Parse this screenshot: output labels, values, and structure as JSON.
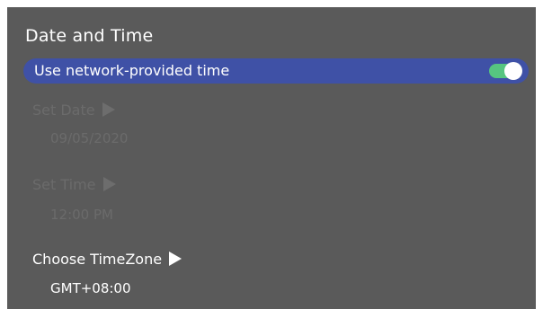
{
  "screen": {
    "title": "Date and Time"
  },
  "network_time": {
    "label": "Use network-provided time",
    "enabled": true
  },
  "set_date": {
    "label": "Set Date",
    "value": "09/05/2020",
    "disabled": true
  },
  "set_time": {
    "label": "Set Time",
    "value": "12:00 PM",
    "disabled": true
  },
  "timezone": {
    "label": "Choose TimeZone",
    "value": "GMT+08:00"
  },
  "colors": {
    "panel_bg": "#5a5a5a",
    "highlight_row": "#3f51a6",
    "toggle_on": "#56c580"
  },
  "icons": {
    "arrow": "play-arrow-icon"
  }
}
